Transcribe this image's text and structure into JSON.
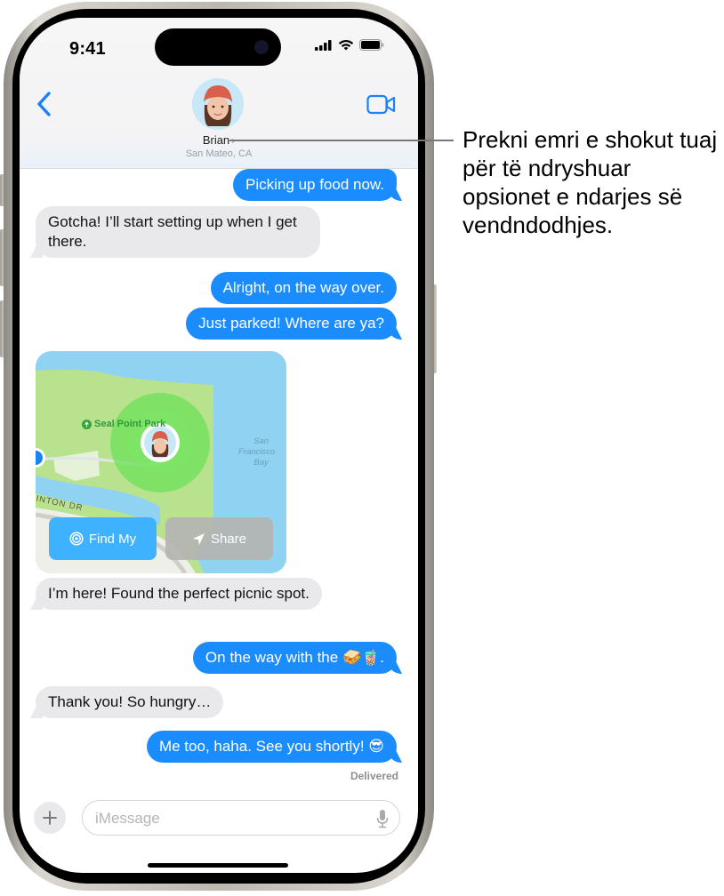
{
  "status_bar": {
    "time": "9:41"
  },
  "header": {
    "contact_name": "Brian",
    "contact_location": "San Mateo, CA"
  },
  "messages": [
    {
      "from": "me",
      "text": "Picking up food now."
    },
    {
      "from": "them",
      "text": "Gotcha! I’ll start setting up when I get there."
    },
    {
      "from": "me",
      "text": "Alright, on the way over."
    },
    {
      "from": "me",
      "text": "Just parked! Where are ya?"
    },
    {
      "from": "them",
      "type": "location"
    },
    {
      "from": "them",
      "text": "I’m here! Found the perfect picnic spot."
    },
    {
      "from": "me",
      "text": "On the way with the 🥪🧋."
    },
    {
      "from": "them",
      "text": "Thank you! So hungry…"
    },
    {
      "from": "me",
      "text": "Me too, haha. See you shortly! 😎"
    }
  ],
  "map": {
    "park_label": "Seal Point Park",
    "bay_label_lines": [
      "San",
      "Francisco",
      "Bay"
    ],
    "road_label": "INTON DR",
    "find_my_label": "Find My",
    "share_label": "Share"
  },
  "delivery_status": "Delivered",
  "composer": {
    "placeholder": "iMessage",
    "value": ""
  },
  "callout": {
    "text": "Prekni emri e shokut tuaj për të ndryshuar opsionet e ndarjes së vendndodhjes."
  },
  "colors": {
    "sent_bubble": "#1b8cfd",
    "received_bubble": "#e9e9eb",
    "accent": "#1a82f7",
    "find_my_button": "#3fb2ff"
  }
}
